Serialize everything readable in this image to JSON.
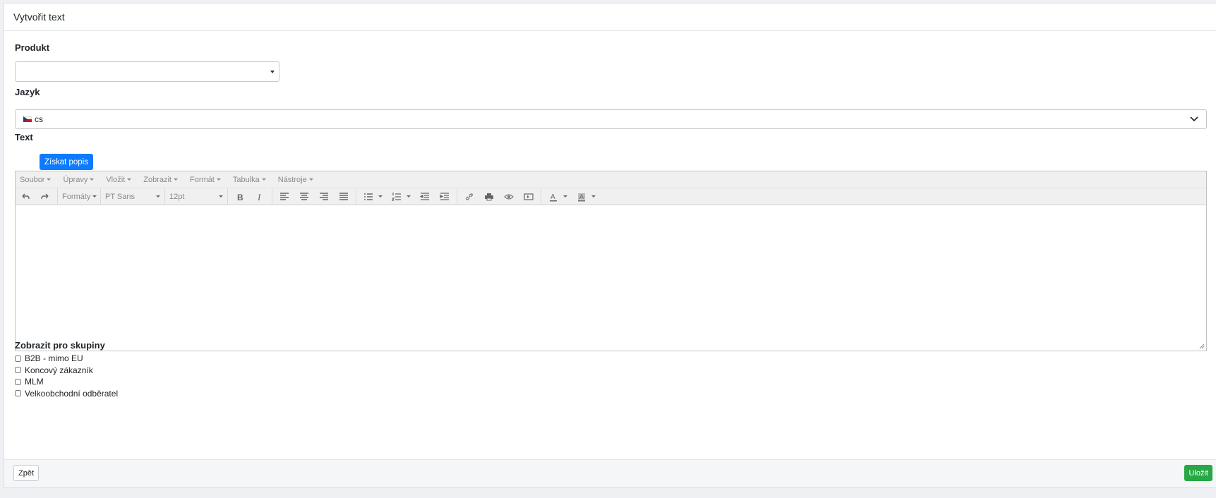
{
  "header": {
    "title": "Vytvořit text"
  },
  "fields": {
    "produkt": {
      "label": "Produkt",
      "value": ""
    },
    "jazyk": {
      "label": "Jazyk",
      "value": "cs"
    },
    "text": {
      "label": "Text",
      "action_label": "Získat popis"
    }
  },
  "editor": {
    "menu": [
      "Soubor",
      "Úpravy",
      "Vložit",
      "Zobrazit",
      "Formát",
      "Tabulka",
      "Nástroje"
    ],
    "formats_label": "Formáty",
    "font_family": "PT Sans",
    "font_size": "12pt"
  },
  "groups": {
    "label": "Zobrazit pro skupiny",
    "items": [
      {
        "label": "B2B - mimo EU",
        "checked": false
      },
      {
        "label": "Koncový zákazník",
        "checked": false
      },
      {
        "label": "MLM",
        "checked": false
      },
      {
        "label": "Velkoobchodní odběratel",
        "checked": false
      }
    ]
  },
  "footer": {
    "back_label": "Zpět",
    "save_label": "Uložit"
  },
  "colors": {
    "primary": "#0d7bff",
    "success": "#28a745"
  }
}
